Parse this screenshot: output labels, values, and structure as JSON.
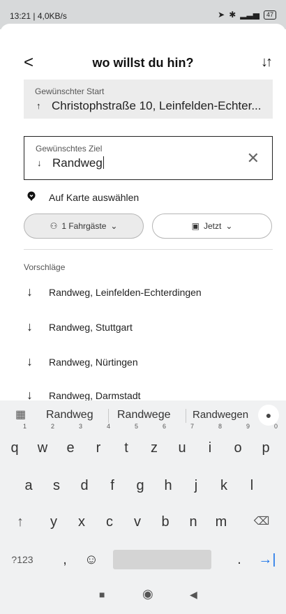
{
  "status_bar": {
    "time": "13:21 | 4,0KB/s",
    "battery": "47"
  },
  "header": {
    "back_icon": "chevron-left-icon",
    "title": "wo willst du hin?",
    "swap_icon": "swap-vertical-icon"
  },
  "start_field": {
    "label": "Gewünschter Start",
    "value": "Christophstraße 10, Leinfelden-Echter..."
  },
  "destination_field": {
    "label": "Gewünschtes Ziel",
    "value": "Randweg"
  },
  "map_pick": {
    "label": "Auf Karte auswählen"
  },
  "passengers": {
    "label": "1 Fahrgäste"
  },
  "time": {
    "label": "Jetzt"
  },
  "suggestions": {
    "heading": "Vorschläge",
    "items": [
      "Randweg, Leinfelden-Echterdingen",
      "Randweg, Stuttgart",
      "Randweg, Nürtingen",
      "Randweg, Darmstadt"
    ]
  },
  "keyboard": {
    "suggestions": [
      "Randweg",
      "Randwege",
      "Randwegen"
    ],
    "row1": [
      "q",
      "w",
      "e",
      "r",
      "t",
      "z",
      "u",
      "i",
      "o",
      "p"
    ],
    "row1_hints": [
      "1",
      "2",
      "3",
      "4",
      "5",
      "6",
      "7",
      "8",
      "9",
      "0"
    ],
    "row2": [
      "a",
      "s",
      "d",
      "f",
      "g",
      "h",
      "j",
      "k",
      "l"
    ],
    "row3": [
      "↑",
      "y",
      "x",
      "c",
      "v",
      "b",
      "n",
      "m",
      "⌫"
    ],
    "row4": {
      "symbols": "?123",
      "comma": ",",
      "emoji": "☺",
      "period": ".",
      "enter": "→|"
    }
  },
  "colors": {
    "accent": "#1a73e8",
    "input_bg": "#ececec"
  }
}
